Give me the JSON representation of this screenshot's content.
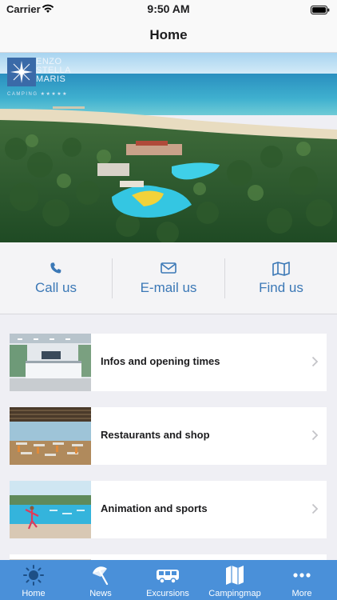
{
  "status_bar": {
    "carrier": "Carrier",
    "time": "9:50 AM"
  },
  "nav": {
    "title": "Home"
  },
  "hero": {
    "logo": {
      "line1": "ENZO",
      "line2": "STELLA",
      "line3": "MARIS",
      "sub": "CAMPING ★★★★★"
    }
  },
  "contact": {
    "call_label": "Call us",
    "email_label": "E-mail us",
    "find_label": "Find us"
  },
  "menu": {
    "items": [
      {
        "label": "Infos and opening times"
      },
      {
        "label": "Restaurants and shop"
      },
      {
        "label": "Animation and sports"
      }
    ]
  },
  "tabs": [
    {
      "label": "Home",
      "icon": "sun-icon"
    },
    {
      "label": "News",
      "icon": "umbrella-icon"
    },
    {
      "label": "Excursions",
      "icon": "van-icon"
    },
    {
      "label": "Campingmap",
      "icon": "map-icon"
    },
    {
      "label": "More",
      "icon": "more-icon"
    }
  ],
  "colors": {
    "accent": "#3b78b6",
    "tab_bar": "#4a90d9",
    "background": "#efeff4"
  }
}
